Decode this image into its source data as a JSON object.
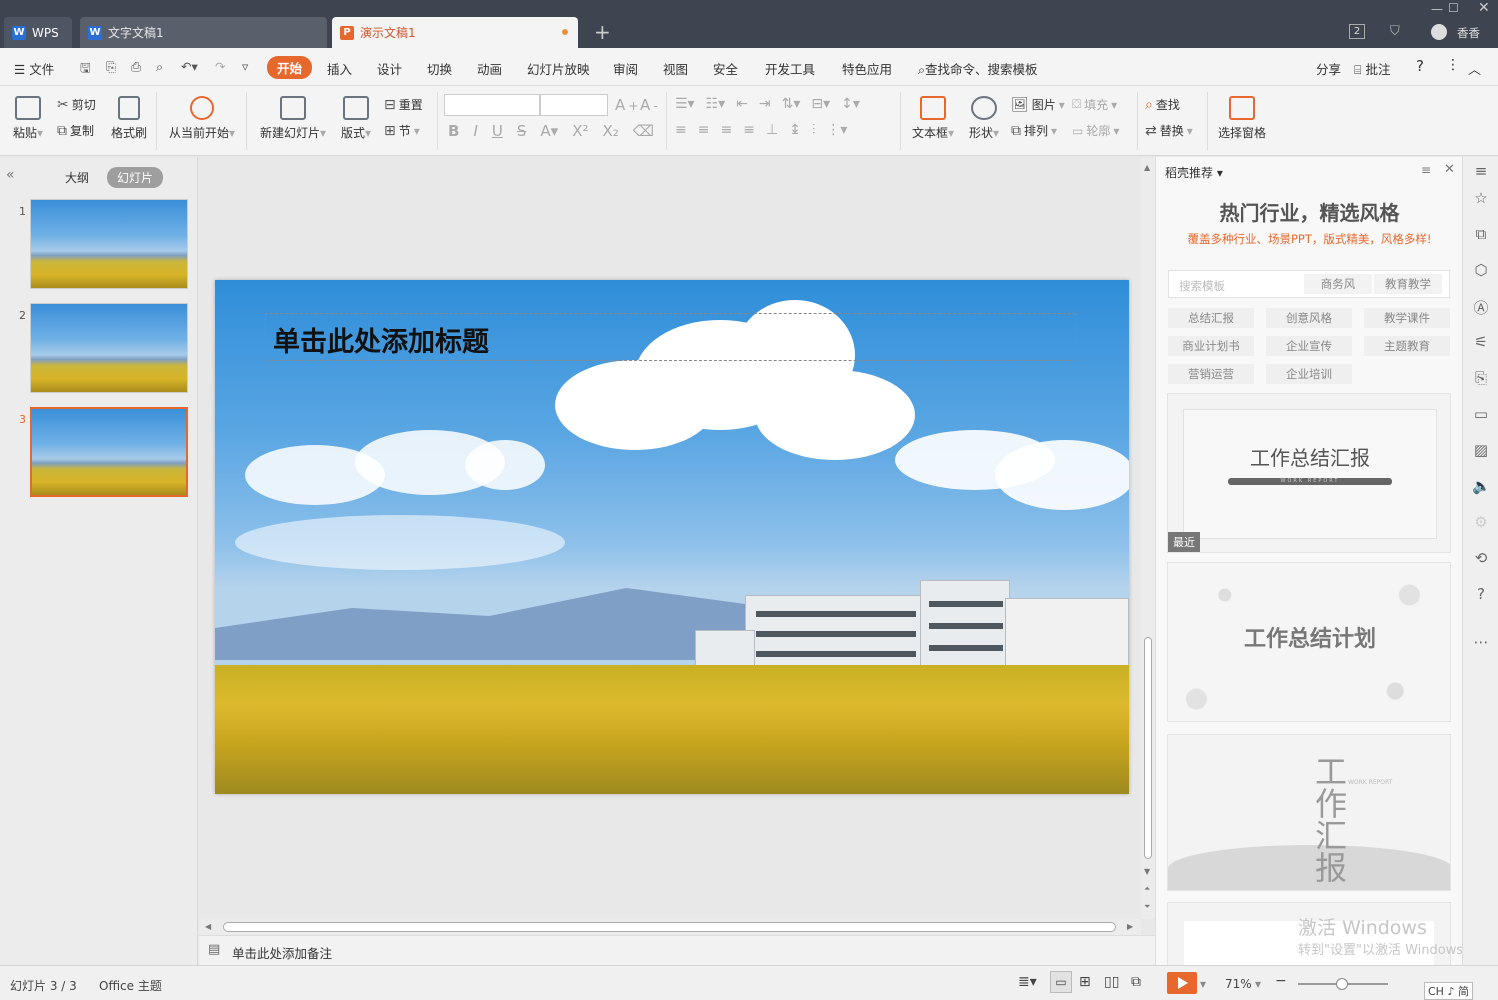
{
  "titlebar": {
    "tabs": [
      {
        "label": "WPS",
        "icon": "wps-logo-icon"
      },
      {
        "label": "文字文稿1",
        "icon": "writer-doc-icon"
      },
      {
        "label": "演示文稿1",
        "icon": "presentation-doc-icon"
      }
    ],
    "user_name": "香香",
    "badge": "2"
  },
  "menubar": {
    "file": "文件",
    "items": [
      "开始",
      "插入",
      "设计",
      "切换",
      "动画",
      "幻灯片放映",
      "审阅",
      "视图",
      "安全",
      "开发工具",
      "特色应用"
    ],
    "active": "开始",
    "search_text": "查找命令、搜索模板",
    "share": "分享",
    "comment": "批注"
  },
  "ribbon": {
    "paste": "粘贴",
    "cut": "剪切",
    "copy": "复制",
    "format_painter": "格式刷",
    "from_current": "从当前开始",
    "new_slide": "新建幻灯片",
    "layout": "版式",
    "reset": "重置",
    "section": "节",
    "textbox": "文本框",
    "shape": "形状",
    "picture": "图片",
    "fill": "填充",
    "arrange": "排列",
    "outline": "轮廓",
    "find": "查找",
    "replace": "替换",
    "selection_pane": "选择窗格"
  },
  "left_panel": {
    "tab_outline": "大纲",
    "tab_slides": "幻灯片",
    "slides": [
      "1",
      "2",
      "3"
    ],
    "selected": "3"
  },
  "slide": {
    "title_placeholder": "单击此处添加标题"
  },
  "notes": {
    "placeholder": "单击此处添加备注"
  },
  "right_panel": {
    "header": "稻壳推荐",
    "hero_title": "热门行业，精选风格",
    "hero_sub": "覆盖多种行业、场景PPT，版式精美，风格多样!",
    "search_placeholder": "搜索模板",
    "search_tags": [
      "商务风",
      "教育教学"
    ],
    "tags": [
      "总结汇报",
      "创意风格",
      "教学课件",
      "商业计划书",
      "企业宣传",
      "主题教育",
      "营销运营",
      "企业培训"
    ],
    "cards": [
      {
        "title": "工作总结汇报",
        "subtitle": "WORK REPORT",
        "badge": "最近"
      },
      {
        "title": "工作总结计划"
      },
      {
        "title": "工作汇报",
        "subtitle": "WORK REPORT"
      },
      {
        "title": ""
      }
    ],
    "watermark_1": "激活 Windows",
    "watermark_2": "转到\"设置\"以激活 Windows。"
  },
  "statusbar": {
    "slide_info": "幻灯片 3 / 3",
    "theme": "Office 主题",
    "zoom": "71%",
    "ime": "CH ♪ 简"
  },
  "colors": {
    "accent": "#e6682d",
    "titlebar": "#3f4550"
  }
}
